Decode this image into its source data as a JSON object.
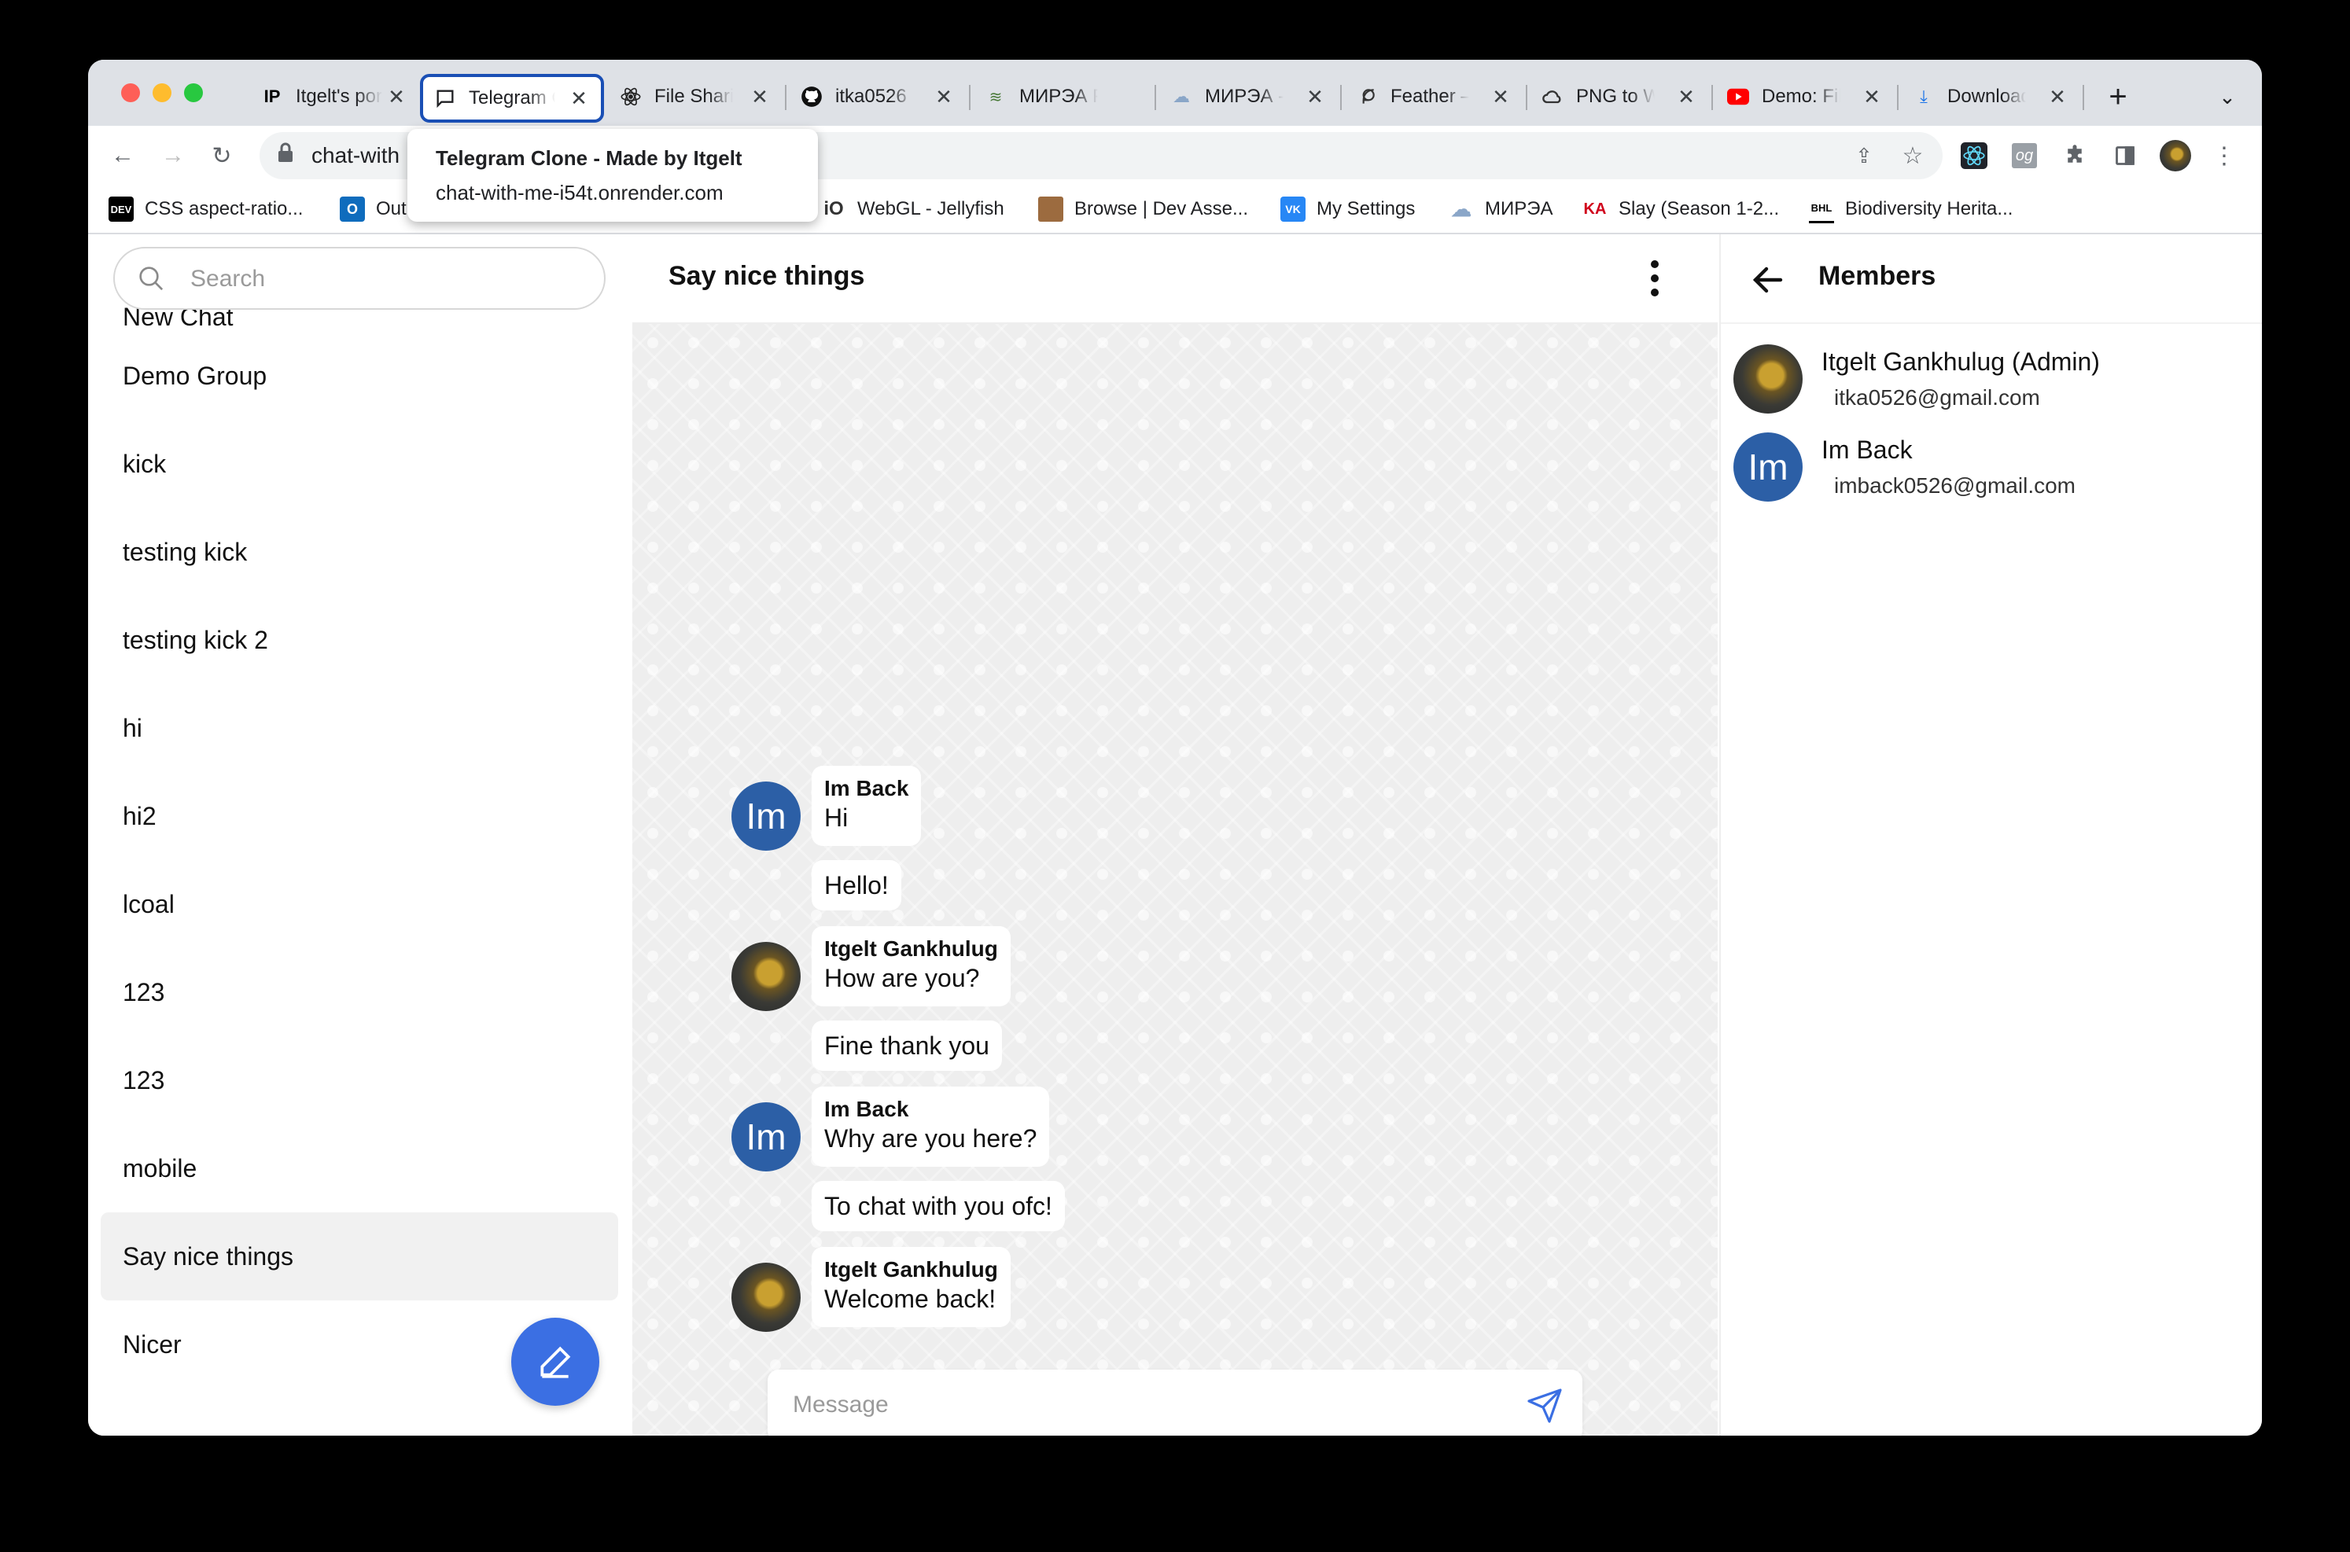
{
  "browser": {
    "tabs": [
      {
        "title": "Itgelt's portfolio",
        "icon": "ip-icon"
      },
      {
        "title": "Telegram Clone",
        "icon": "chat-bubble-icon"
      },
      {
        "title": "File Sharing",
        "icon": "react-icon"
      },
      {
        "title": "itka0526",
        "icon": "github-icon"
      },
      {
        "title": "МИРЭА Расписание",
        "icon": "mirea-icon"
      },
      {
        "title": "МИРЭА - ",
        "icon": "mirea-cloud-icon"
      },
      {
        "title": "Feather – Simply beautiful",
        "icon": "feather-icon"
      },
      {
        "title": "PNG to WebP",
        "icon": "cloud-icon"
      },
      {
        "title": "Demo: File sharing",
        "icon": "youtube-icon"
      },
      {
        "title": "Downloads",
        "icon": "download-icon"
      }
    ],
    "url": "chat-with-me-i54t.onrender.com",
    "url_visible": "chat-with",
    "tooltip": {
      "title": "Telegram Clone - Made by Itgelt",
      "url": "chat-with-me-i54t.onrender.com"
    },
    "bookmarks": [
      {
        "label": "CSS aspect-ratio...",
        "icon": "DEV"
      },
      {
        "label": "Out",
        "icon": "O"
      },
      {
        "label": "WebGL - Jellyfish",
        "icon": "iO"
      },
      {
        "label": "Browse | Dev Asse...",
        "icon": "box"
      },
      {
        "label": "My Settings",
        "icon": "VK"
      },
      {
        "label": "МИРЭА",
        "icon": "cloud"
      },
      {
        "label": "Slay (Season 1-2...",
        "icon": "KA"
      },
      {
        "label": "Biodiversity Herita...",
        "icon": "BHL"
      }
    ]
  },
  "sidebar": {
    "search_placeholder": "Search",
    "partial_item": "New Chat",
    "chats": [
      "Demo Group",
      "kick",
      "testing kick",
      "testing kick 2",
      "hi",
      "hi2",
      "lcoal",
      "123",
      "123",
      "mobile",
      "Say nice things",
      "Nicer"
    ],
    "selected": "Say nice things"
  },
  "chat": {
    "title": "Say nice things",
    "composer_placeholder": "Message",
    "messages": [
      {
        "sender": "Im Back",
        "text": "Hi",
        "avatar": "Im"
      },
      {
        "sender": "",
        "text": "Hello!",
        "avatar": ""
      },
      {
        "sender": "Itgelt Gankhulug",
        "text": "How are you?",
        "avatar": "photo"
      },
      {
        "sender": "",
        "text": "Fine thank you",
        "avatar": ""
      },
      {
        "sender": "Im Back",
        "text": "Why are you here?",
        "avatar": "Im"
      },
      {
        "sender": "",
        "text": "To chat with you ofc!",
        "avatar": ""
      },
      {
        "sender": "Itgelt Gankhulug",
        "text": "Welcome back!",
        "avatar": "photo"
      }
    ]
  },
  "members": {
    "title": "Members",
    "list": [
      {
        "name": "Itgelt Gankhulug (Admin)",
        "email": "itka0526@gmail.com",
        "avatar": "photo"
      },
      {
        "name": "Im Back",
        "email": "imback0526@gmail.com",
        "avatar": "Im"
      }
    ]
  },
  "colors": {
    "accent": "#3b6fe3",
    "avatar_blue": "#2c5fa6",
    "active_tab_border": "#1a4fb5"
  }
}
